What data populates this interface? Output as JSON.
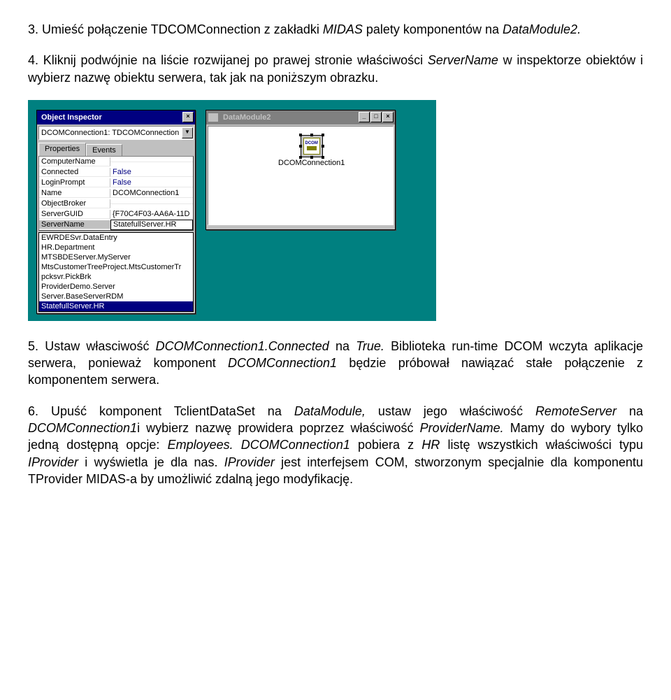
{
  "para1": {
    "num": "3. ",
    "t1": "Umieść połączenie TDCOMConnection z zakładki ",
    "i1": "MIDAS",
    "t2": " palety komponentów na ",
    "i2": "DataModule2.",
    "t3": ""
  },
  "para2": {
    "num": "4. ",
    "t1": "Kliknij podwójnie na liście rozwijanej po prawej stronie właściwości ",
    "i1": "ServerName",
    "t2": " w inspektorze obiektów i wybierz nazwę obiektu serwera, tak jak na poniższym obrazku."
  },
  "inspector": {
    "title": "Object Inspector",
    "combo": "DCOMConnection1: TDCOMConnection",
    "tabs": {
      "active": "Properties",
      "inactive": "Events"
    },
    "props": [
      {
        "name": "ComputerName",
        "value": ""
      },
      {
        "name": "Connected",
        "value": "False"
      },
      {
        "name": "LoginPrompt",
        "value": "False"
      },
      {
        "name": "Name",
        "value": "DCOMConnection1"
      },
      {
        "name": "ObjectBroker",
        "value": ""
      },
      {
        "name": "ServerGUID",
        "value": "{F70C4F03-AA6A-11D"
      },
      {
        "name": "ServerName",
        "value": "StatefullServer.HR"
      }
    ],
    "dropdown": [
      "EWRDESvr.DataEntry",
      "HR.Department",
      "MTSBDEServer.MyServer",
      "MtsCustomerTreeProject.MtsCustomerTr",
      "pcksvr.PickBrk",
      "ProviderDemo.Server",
      "Server.BaseServerRDM",
      "StatefullServer.HR"
    ]
  },
  "datamodule": {
    "title": "DataModule2",
    "component_label": "DCOMConnection1",
    "icon_text": "DCOM"
  },
  "para5": {
    "num": "5. ",
    "t1": "Ustaw własciwość ",
    "i1": "DCOMConnection1.Connected",
    "t2": " na ",
    "i2": "True.",
    "t3": " Biblioteka run-time DCOM wczyta aplikacje serwera, ponieważ komponent ",
    "i3": "DCOMConnection1",
    "t4": " będzie próbował nawiązać stałe połączenie z komponentem serwera."
  },
  "para6": {
    "num": "6. ",
    "t1": "Upuść komponent TclientDataSet na ",
    "i1": "DataModule,",
    "t2": " ustaw jego właściwość ",
    "i2": "RemoteServer",
    "t3": " na ",
    "i3": "DCOMConnection1",
    "t4": "i wybierz nazwę prowidera poprzez właściwość ",
    "i4": "ProviderName.",
    "t5": " Mamy do wybory tylko jedną dostępną opcje: ",
    "i5": "Employees. DCOMConnection1",
    "t6": " pobiera z ",
    "i6": "HR",
    "t7": " listę wszystkich właściwości typu ",
    "i7": "IProvider",
    "t8": " i wyświetla je dla nas. ",
    "i8": "IProvider",
    "t9": " jest interfejsem COM, stworzonym specjalnie dla komponentu TProvider MIDAS-a by umożliwić zdalną jego modyfikację."
  }
}
